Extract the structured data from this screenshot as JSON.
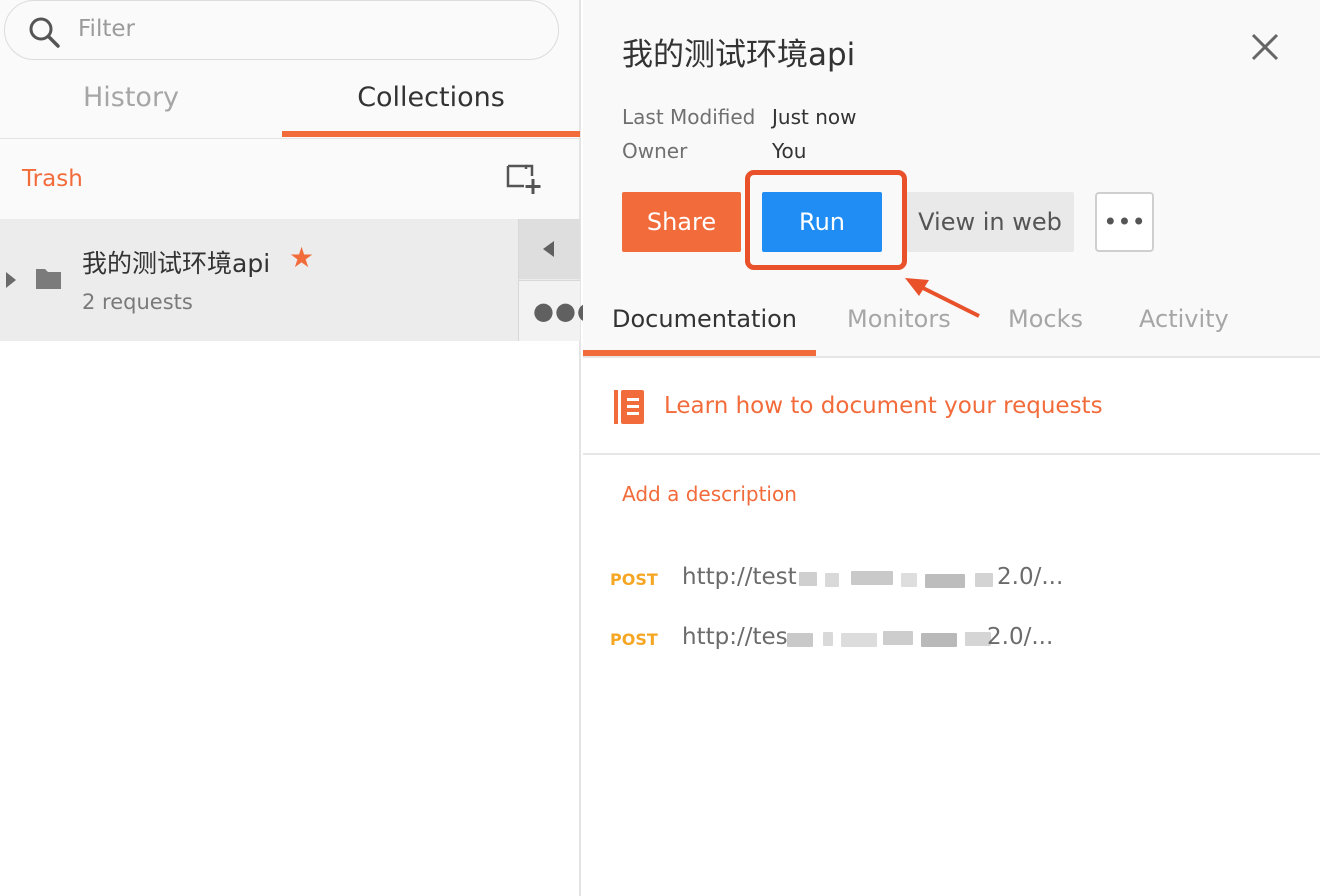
{
  "sidebar": {
    "filter_placeholder": "Filter",
    "tabs": [
      {
        "label": "History",
        "active": false
      },
      {
        "label": "Collections",
        "active": true
      }
    ],
    "trash_label": "Trash",
    "collections": [
      {
        "name": "我的测试环境api",
        "starred": true,
        "count_label": "2 requests"
      }
    ]
  },
  "panel": {
    "title": "我的测试环境api",
    "meta": [
      {
        "label": "Last Modified",
        "value": "Just now"
      },
      {
        "label": "Owner",
        "value": "You"
      }
    ],
    "buttons": {
      "share": "Share",
      "run": "Run",
      "view_web": "View in web",
      "more": "•••"
    },
    "tabs": [
      {
        "label": "Documentation",
        "active": true
      },
      {
        "label": "Monitors",
        "active": false
      },
      {
        "label": "Mocks",
        "active": false
      },
      {
        "label": "Activity",
        "active": false
      }
    ],
    "learn_link": "Learn how to document your requests",
    "add_description": "Add a description",
    "requests": [
      {
        "method": "POST",
        "url_start": "http://test",
        "url_end": "2.0/..."
      },
      {
        "method": "POST",
        "url_start": "http://tes",
        "url_end": "2.0/..."
      }
    ]
  },
  "colors": {
    "accent": "#f26b3a",
    "run_blue": "#1f8df4",
    "highlight_red": "#e8512a",
    "post_method": "#f5a623"
  },
  "icons": {
    "search": "search-icon",
    "new_collection": "new-collection-icon",
    "folder": "folder-icon",
    "star": "star-icon",
    "close": "close-icon",
    "book": "book-icon"
  }
}
